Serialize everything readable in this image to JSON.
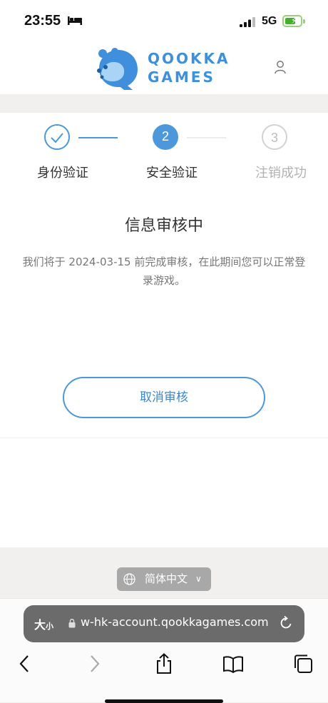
{
  "status_bar": {
    "time": "23:55",
    "network": "5G"
  },
  "header": {
    "brand_line1": "QOOKKA",
    "brand_line2": "GAMES"
  },
  "steps": [
    {
      "label": "身份验证",
      "state": "done"
    },
    {
      "label": "安全验证",
      "number": "2",
      "state": "current"
    },
    {
      "label": "注销成功",
      "number": "3",
      "state": "pending"
    }
  ],
  "main": {
    "title": "信息审核中",
    "description": "我们将于 2024-03-15 前完成审核，在此期间您可以正常登录游戏。",
    "cancel_button": "取消审核"
  },
  "language": {
    "selected": "简体中文",
    "chevron": "∨"
  },
  "browser": {
    "text_size": "大",
    "text_size_small": "小",
    "url": "w-hk-account.qookkagames.com"
  },
  "colors": {
    "accent": "#4c98db",
    "inactive": "#b2b2b2",
    "url_bar": "#6b6b6b"
  }
}
